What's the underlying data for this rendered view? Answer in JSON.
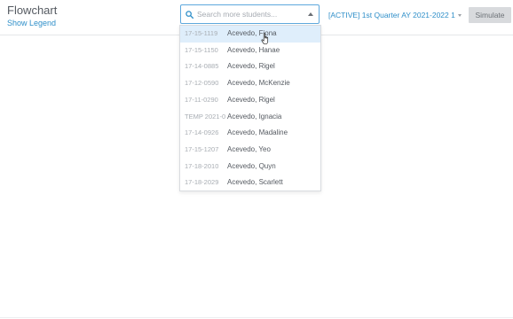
{
  "header": {
    "title": "Flowchart",
    "show_legend_label": "Show Legend"
  },
  "search": {
    "placeholder": "Search more students...",
    "value": ""
  },
  "quarter_select": {
    "selected": "[ACTIVE] 1st Quarter AY 2021-2022 1"
  },
  "toolbar": {
    "simulate_label": "Simulate"
  },
  "dropdown": {
    "options": [
      {
        "id": "17-15-1119",
        "name": "Acevedo, Fiona",
        "highlighted": true
      },
      {
        "id": "17-15-1150",
        "name": "Acevedo, Hanae"
      },
      {
        "id": "17-14-0885",
        "name": "Acevedo, Rigel"
      },
      {
        "id": "17-12-0590",
        "name": "Acevedo, McKenzie"
      },
      {
        "id": "17-11-0290",
        "name": "Acevedo, Rigel"
      },
      {
        "id": "TEMP 2021-0",
        "name": "Acevedo, Ignacia"
      },
      {
        "id": "17-14-0926",
        "name": "Acevedo, Madaline"
      },
      {
        "id": "17-15-1207",
        "name": "Acevedo, Yeo"
      },
      {
        "id": "17-18-2010",
        "name": "Acevedo, Quyn"
      },
      {
        "id": "17-18-2029",
        "name": "Acevedo, Scarlett"
      }
    ]
  },
  "colors": {
    "accent": "#2f8fc9",
    "highlight": "#dfeefb",
    "button_bg": "#d8dadd"
  }
}
